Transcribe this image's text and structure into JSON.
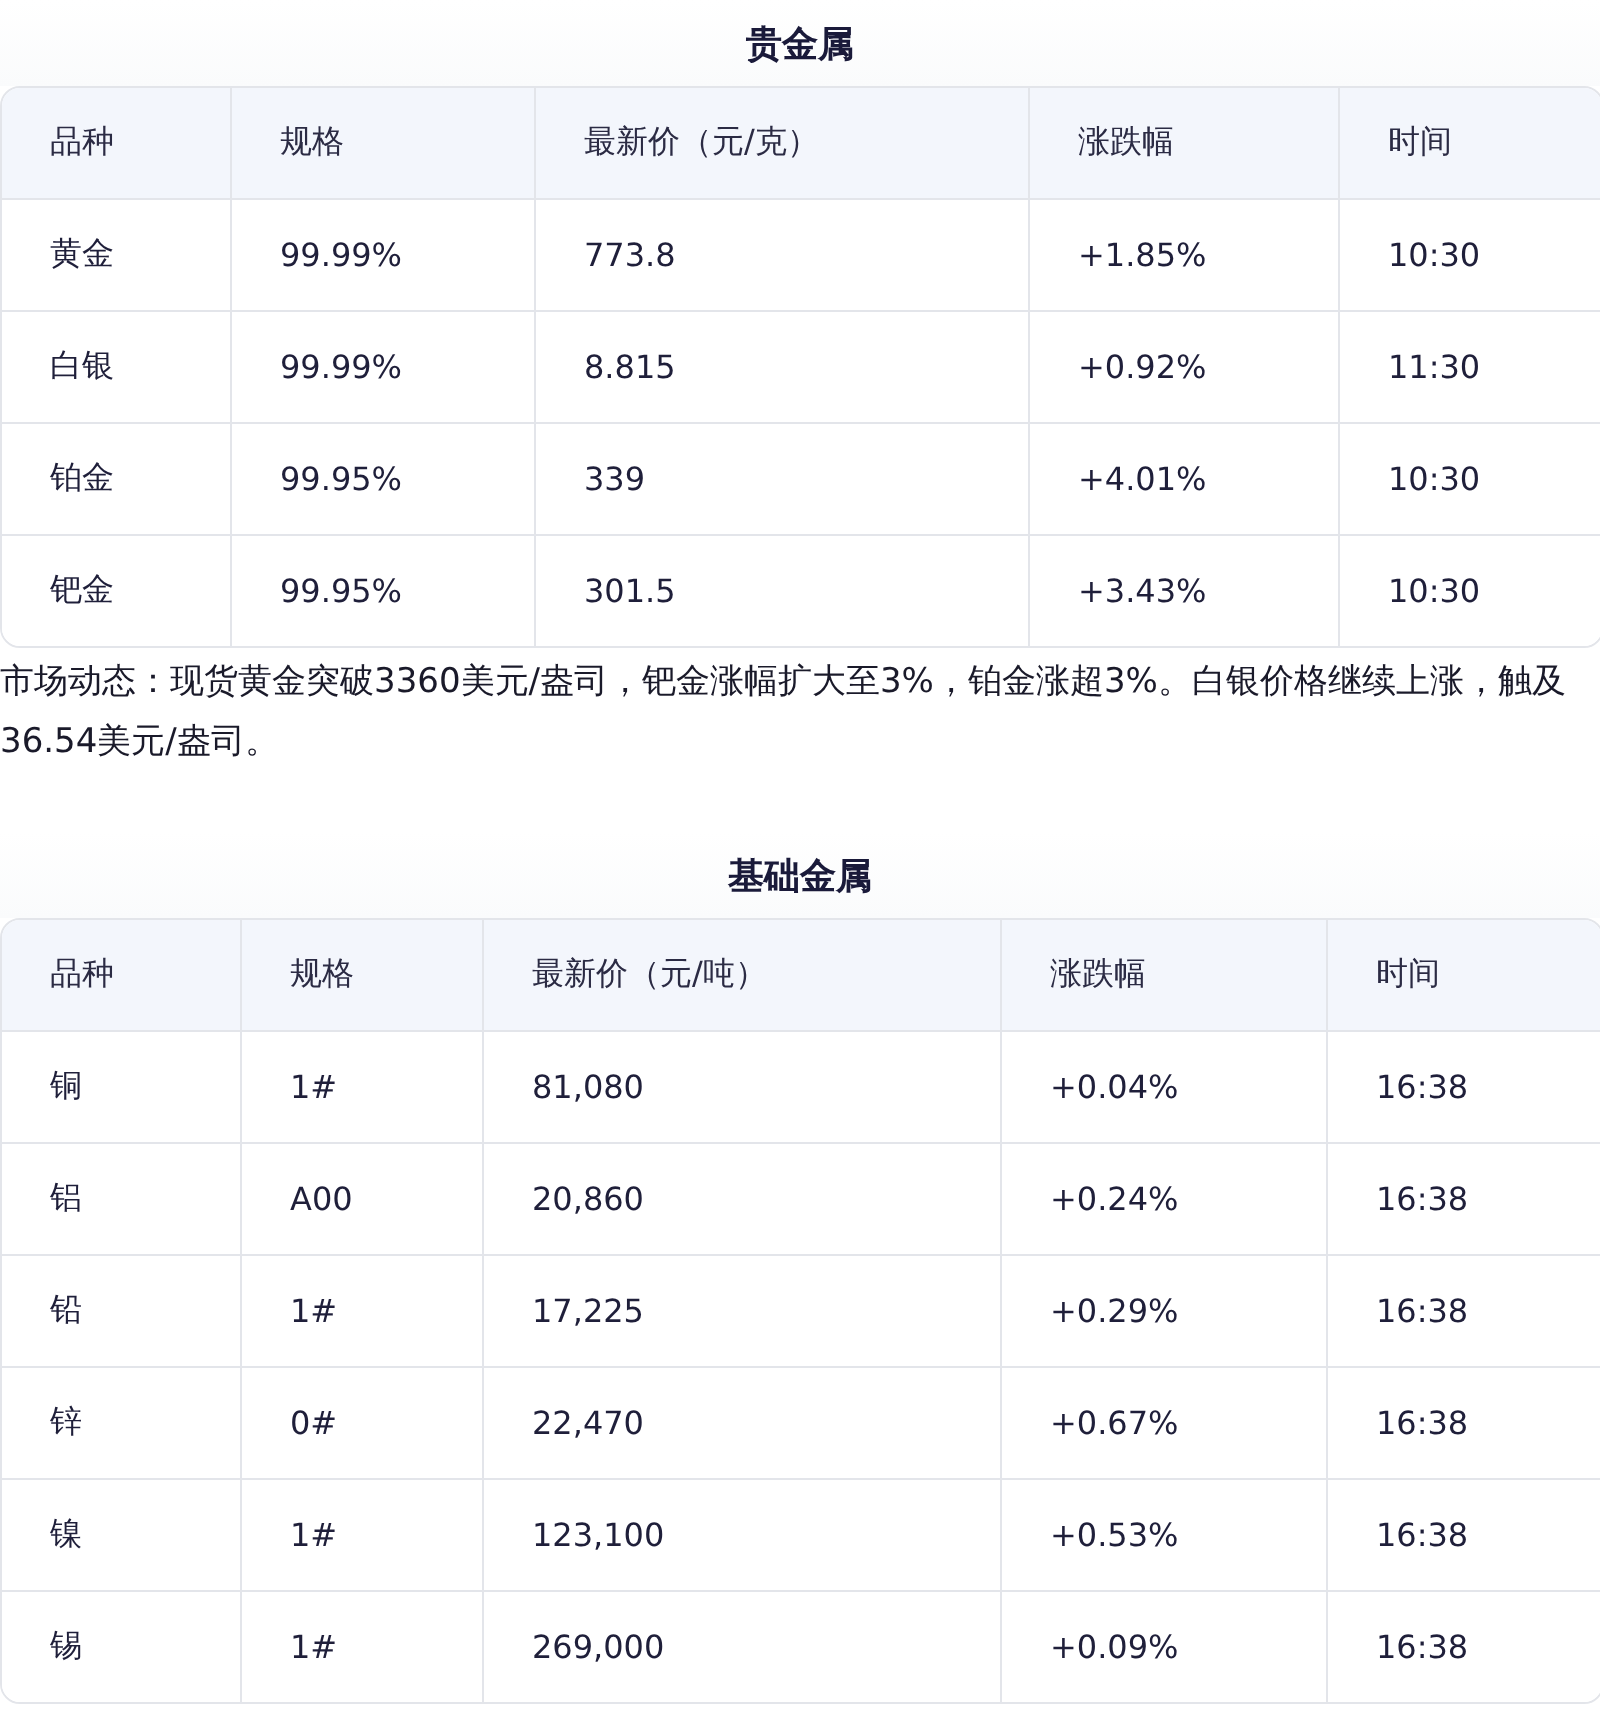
{
  "sections": [
    {
      "title": "贵金属",
      "table": {
        "columns": [
          "品种",
          "规格",
          "最新价（元/克）",
          "涨跌幅",
          "时间"
        ],
        "rows": [
          [
            "黄金",
            "99.99%",
            "773.8",
            "+1.85%",
            "10:30"
          ],
          [
            "白银",
            "99.99%",
            "8.815",
            "+0.92%",
            "11:30"
          ],
          [
            "铂金",
            "99.95%",
            "339",
            "+4.01%",
            "10:30"
          ],
          [
            "钯金",
            "99.95%",
            "301.5",
            "+3.43%",
            "10:30"
          ]
        ]
      },
      "note": "市场动态：现货黄金突破3360美元/盎司，钯金涨幅扩大至3%，铂金涨超3%。白银价格继续上涨，触及36.54美元/盎司。"
    },
    {
      "title": "基础金属",
      "table": {
        "columns": [
          "品种",
          "规格",
          "最新价（元/吨）",
          "涨跌幅",
          "时间"
        ],
        "rows": [
          [
            "铜",
            "1#",
            "81,080",
            "+0.04%",
            "16:38"
          ],
          [
            "铝",
            "A00",
            "20,860",
            "+0.24%",
            "16:38"
          ],
          [
            "铅",
            "1#",
            "17,225",
            "+0.29%",
            "16:38"
          ],
          [
            "锌",
            "0#",
            "22,470",
            "+0.67%",
            "16:38"
          ],
          [
            "镍",
            "1#",
            "123,100",
            "+0.53%",
            "16:38"
          ],
          [
            "锡",
            "1#",
            "269,000",
            "+0.09%",
            "16:38"
          ]
        ]
      }
    }
  ]
}
